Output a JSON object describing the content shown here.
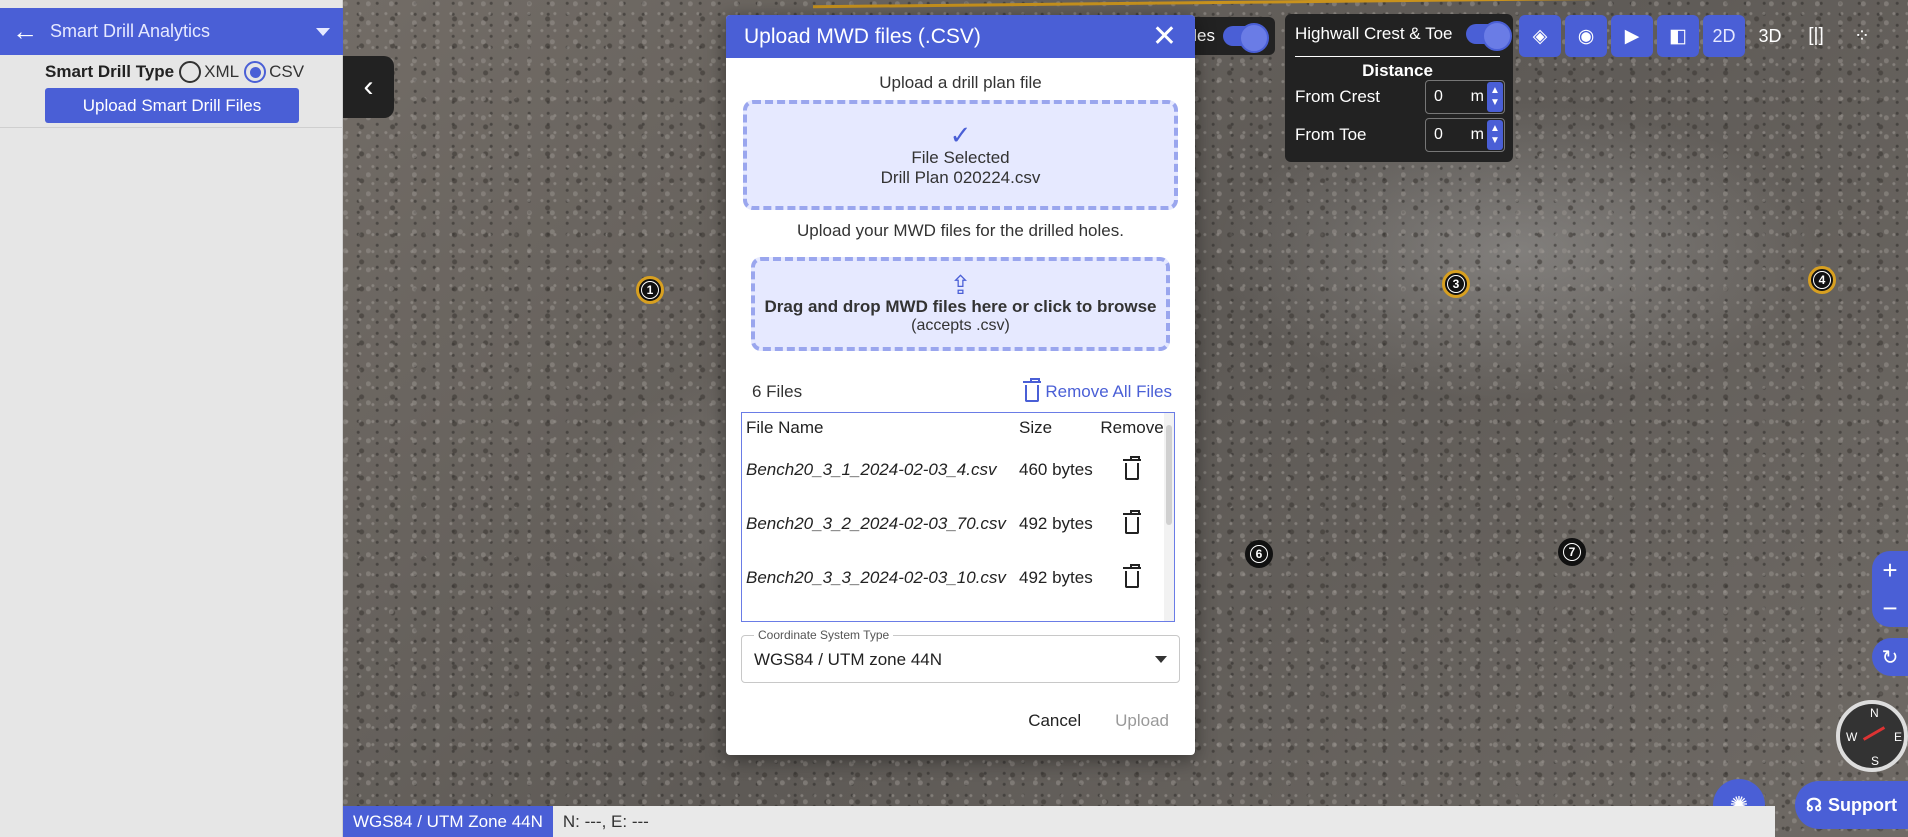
{
  "left_panel": {
    "title": "Smart Drill Analytics",
    "type_label": "Smart Drill Type",
    "radio_xml": "XML",
    "radio_csv": "CSV",
    "selected_type": "CSV",
    "upload_button": "Upload Smart Drill Files"
  },
  "map": {
    "markers": [
      "1",
      "3",
      "4",
      "6",
      "7"
    ]
  },
  "layers": {
    "partial_label": "les",
    "highwall_label": "Highwall Crest & Toe",
    "distance_title": "Distance",
    "from_crest_label": "From Crest",
    "from_crest_value": "0",
    "from_toe_label": "From Toe",
    "from_toe_value": "0",
    "unit": "m"
  },
  "toolbar": {
    "view_2d": "2D",
    "view_3d": "3D"
  },
  "status_bar": {
    "crs": "WGS84 / UTM Zone 44N",
    "coords": "N: ---, E: ---"
  },
  "support_label": "Support",
  "compass": {
    "n": "N",
    "s": "S",
    "e": "E",
    "w": "W"
  },
  "modal": {
    "title": "Upload MWD files (.CSV)",
    "plan_section_label": "Upload a drill plan file",
    "plan_status": "File Selected",
    "plan_file": "Drill Plan 020224.csv",
    "mwd_section_label": "Upload your MWD files for the drilled holes.",
    "drop_text": "Drag and drop MWD files here or click to browse",
    "drop_accepts": "(accepts .csv)",
    "file_count": "6 Files",
    "remove_all": "Remove All Files",
    "columns": {
      "name": "File Name",
      "size": "Size",
      "remove": "Remove"
    },
    "files": [
      {
        "name": "Bench20_3_1_2024-02-03_4.csv",
        "size": "460 bytes"
      },
      {
        "name": "Bench20_3_2_2024-02-03_70.csv",
        "size": "492 bytes"
      },
      {
        "name": "Bench20_3_3_2024-02-03_10.csv",
        "size": "492 bytes"
      }
    ],
    "coord_legend": "Coordinate System Type",
    "coord_value": "WGS84 / UTM zone 44N",
    "cancel": "Cancel",
    "upload": "Upload"
  }
}
